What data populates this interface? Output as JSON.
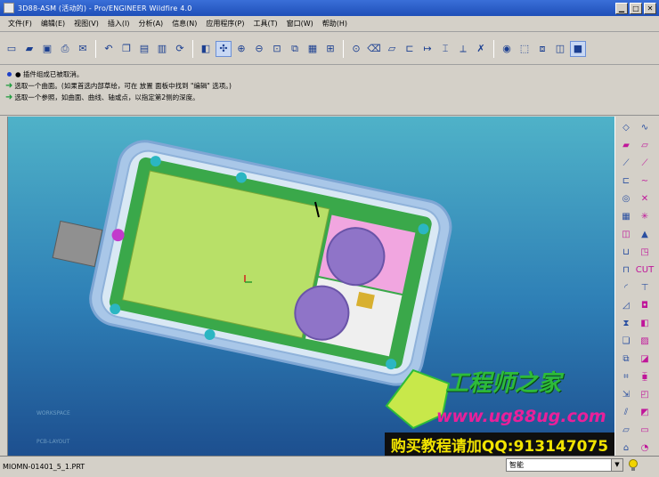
{
  "window": {
    "title": "3D88-ASM (活动的) - Pro/ENGINEER Wildfire 4.0",
    "controls": [
      "minimize",
      "maximize",
      "close"
    ]
  },
  "menu": {
    "items": [
      "文件(F)",
      "编辑(E)",
      "视图(V)",
      "插入(I)",
      "分析(A)",
      "信息(N)",
      "应用程序(P)",
      "工具(T)",
      "窗口(W)",
      "帮助(H)"
    ]
  },
  "toolbar": {
    "icons": [
      "new-icon",
      "open-icon",
      "save-icon",
      "print-icon",
      "email-icon",
      "undo-icon",
      "copy-icon",
      "paste-icon",
      "paste-special-icon",
      "regenerate-icon",
      "zoom-in-icon",
      "zoom-out-icon",
      "refit-icon",
      "reorient-icon",
      "saved-views-icon",
      "layers-icon",
      "model-display-icon",
      "hide-icon",
      "datum-plane-icon",
      "datum-axis-icon",
      "datum-point-icon",
      "coord-sys-icon",
      "csys-display-icon",
      "sketch-icon",
      "spin-center-icon",
      "wireframe-icon",
      "hidden-line-icon",
      "no-hidden-icon",
      "shading-icon"
    ],
    "active_index": 1
  },
  "messages": [
    {
      "type": "info",
      "text": "● 插件组成已被取消。"
    },
    {
      "type": "prompt",
      "text": "选取一个曲面。(如果首选内部草绘，可在 放置 面板中找到 \"编辑\" 选项。)"
    },
    {
      "type": "prompt",
      "text": "选取一个参照，如曲面、曲线、轴或点，以指定第2侧的深度。"
    }
  ],
  "right_panel": {
    "left_col": [
      "sketcher-icon",
      "sketch-plane-icon",
      "datum-axis-icon",
      "revolve-icon",
      "array-icon",
      "hole-icon",
      "shell-icon",
      "draft-icon",
      "rib-icon",
      "round-icon",
      "chamfer-icon",
      "mirror-icon",
      "copy-icon",
      "merge-icon",
      "trim-icon",
      "extend-icon",
      "offset-icon",
      "thicken-icon",
      "solidify-icon",
      "boundary-icon"
    ],
    "right_col": [
      "curve-icon",
      "plane-icon",
      "line-icon",
      "spline-icon",
      "point-icon",
      "csys-icon",
      "mesh-icon",
      "sweep-icon",
      "blend-icon",
      "extrude-icon",
      "cut-icon",
      "protrusion-icon",
      "surface-icon",
      "fill-icon",
      "intersect-icon",
      "project-icon",
      "wrap-icon",
      "flatten-icon",
      "cosmetic-icon",
      "pattern-icon"
    ]
  },
  "viewport": {
    "faint_labels": [
      "WORKSPACE",
      "PCB-LAYOUT"
    ]
  },
  "watermark": {
    "title": "工程师之家",
    "url": "www.ug88ug.com",
    "buy": "购买教程请加QQ:913147075"
  },
  "status": {
    "file": "MIOMN-01401_5_1.PRT",
    "filter_value": "智能"
  },
  "colors": {
    "viewport_top": "#4fb2c8",
    "viewport_bottom": "#1d4f8f",
    "pcb_green": "#3aa84a",
    "battery_green": "#b8e068",
    "speaker_purple": "#8f74c8"
  }
}
